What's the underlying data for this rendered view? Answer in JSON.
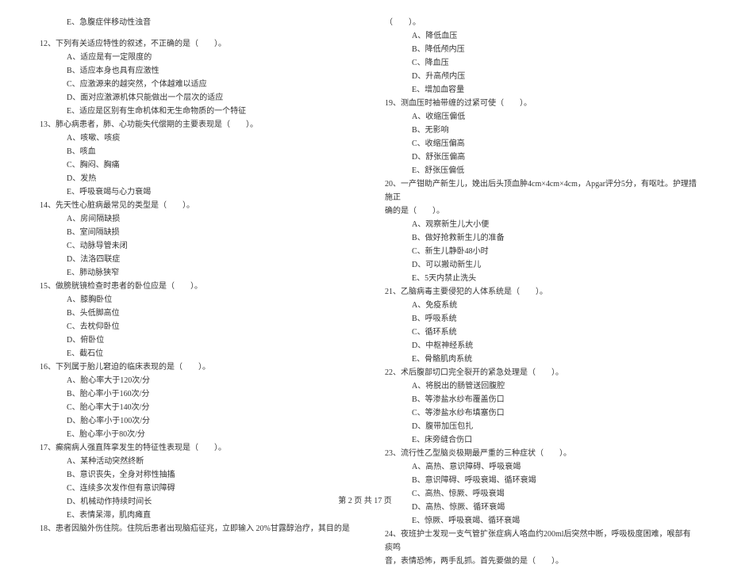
{
  "left": {
    "prefix_option": "E、急腹症伴移动性浊音",
    "q12": {
      "stem": "12、下列有关适应特性的叙述，不正确的是（　　）。",
      "opts": [
        "A、适应是有一定限度的",
        "B、适应本身也具有应激性",
        "C、应激源来的越突然，个体越难以适应",
        "D、面对应激源机体只能做出一个层次的适应",
        "E、适应是区别有生命机体和无生命物质的一个特征"
      ]
    },
    "q13": {
      "stem": "13、肺心病患者，肺、心功能失代偿期的主要表现是（　　）。",
      "opts": [
        "A、咳嗽、咳痰",
        "B、咳血",
        "C、胸闷、胸痛",
        "D、发热",
        "E、呼吸衰竭与心力衰竭"
      ]
    },
    "q14": {
      "stem": "14、先天性心脏病最常见的类型是（　　）。",
      "opts": [
        "A、房间隔缺损",
        "B、室间隔缺损",
        "C、动脉导管未闭",
        "D、法洛四联症",
        "E、肺动脉狭窄"
      ]
    },
    "q15": {
      "stem": "15、做膀胱镜检查时患者的卧位应是（　　）。",
      "opts": [
        "A、膝胸卧位",
        "B、头低脚高位",
        "C、去枕仰卧位",
        "D、俯卧位",
        "E、截石位"
      ]
    },
    "q16": {
      "stem": "16、下列属于胎儿窘迫的临床表现的是（　　）。",
      "opts": [
        "A、胎心率大于120次/分",
        "B、胎心率小于160次/分",
        "C、胎心率大于140次/分",
        "D、胎心率小于100次/分",
        "E、胎心率小于80次/分"
      ]
    },
    "q17": {
      "stem": "17、癫痫病人强直阵挛发生的特征性表现是（　　）。",
      "opts": [
        "A、某种活动突然终断",
        "B、意识丧失，全身对称性抽搐",
        "C、连续多次发作但有意识障碍",
        "D、机械动作持续时间长",
        "E、表情呆滞，肌肉瘫直"
      ]
    },
    "q18": {
      "stem": "18、患者因脑外伤住院。住院后患者出现脑疝征兆，立即输入 20%甘露醇治疗，其目的是"
    }
  },
  "right": {
    "q18_cont": "（　　）。",
    "q18_opts": [
      "A、降低血压",
      "B、降低颅内压",
      "C、降血压",
      "D、升高颅内压",
      "E、增加血容量"
    ],
    "q19": {
      "stem": "19、测血压时袖带缠的过紧可使（　　）。",
      "opts": [
        "A、收缩压偏低",
        "B、无影响",
        "C、收缩压偏高",
        "D、舒张压偏高",
        "E、舒张压偏低"
      ]
    },
    "q20": {
      "stem1": "20、一产钳助产新生儿，娩出后头顶血肿4cm×4cm×4cm，Apgar评分5分，有呕吐。护理措施正",
      "stem2": "确的是（　　）。",
      "opts": [
        "A、观察新生儿大小便",
        "B、做好抢救新生儿的准备",
        "C、新生儿静卧48小时",
        "D、可以搬动新生儿",
        "E、5天内禁止洗头"
      ]
    },
    "q21": {
      "stem": "21、乙脑病毒主要侵犯的人体系统是（　　）。",
      "opts": [
        "A、免疫系统",
        "B、呼吸系统",
        "C、循环系统",
        "D、中枢神经系统",
        "E、骨骼肌肉系统"
      ]
    },
    "q22": {
      "stem": "22、术后腹部切口完全裂开的紧急处理是（　　）。",
      "opts": [
        "A、将脱出的肠管送回腹腔",
        "B、等渗盐水纱布覆盖伤口",
        "C、等渗盐水纱布填塞伤口",
        "D、腹带加压包扎",
        "E、床旁缝合伤口"
      ]
    },
    "q23": {
      "stem": "23、流行性乙型脑炎极期最严重的三种症状（　　）。",
      "opts": [
        "A、高热、意识障碍、呼吸衰竭",
        "B、意识障碍、呼吸衰竭、循环衰竭",
        "C、高热、惊厥、呼吸衰竭",
        "D、高热、惊厥、循环衰竭",
        "E、惊厥、呼吸衰竭、循环衰竭"
      ]
    },
    "q24": {
      "stem1": "24、夜班护士发现一支气管扩张症病人咯血约200ml后突然中断，呼吸极度困难，喉部有痰鸣",
      "stem2": "音，表情恐怖，两手乱抓。首先要做的是（　　）。"
    }
  },
  "footer": "第 2 页 共 17 页"
}
